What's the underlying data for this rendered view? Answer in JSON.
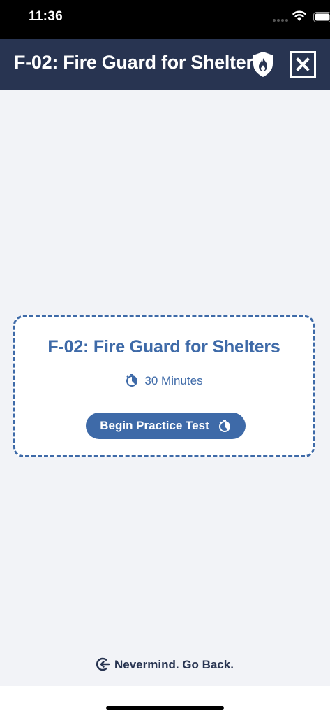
{
  "status_bar": {
    "time": "11:36"
  },
  "header": {
    "title": "F-02: Fire Guard for Shelters",
    "icons": [
      "shield-fire-icon",
      "close-icon"
    ]
  },
  "card": {
    "title": "F-02: Fire Guard for Shelters",
    "duration": "30 Minutes",
    "button_label": "Begin Practice Test"
  },
  "footer": {
    "back_label": "Nevermind. Go Back."
  },
  "colors": {
    "header_bg": "#283451",
    "accent": "#3e6aa8",
    "page_bg": "#f2f3f7"
  }
}
